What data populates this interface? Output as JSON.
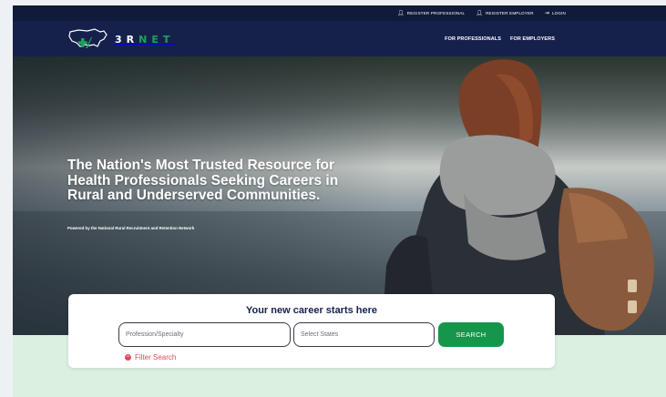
{
  "topbar": {
    "links": [
      {
        "label": "REGISTER PROFESSIONAL",
        "icon": "user-icon"
      },
      {
        "label": "REGISTER EMPLOYER",
        "icon": "user-icon"
      },
      {
        "label": "LOGIN",
        "icon": "login-icon"
      }
    ]
  },
  "nav": {
    "logo": "3RNET",
    "menu": [
      "FOR PROFESSIONALS",
      "FOR EMPLOYERS"
    ]
  },
  "hero": {
    "title": "The Nation's Most Trusted Resource for Health Professionals Seeking Careers in Rural and Underserved Communities.",
    "subtitle": "Powered by the National Rural Recruitment and Retention Network"
  },
  "search": {
    "heading": "Your new career starts here",
    "profession_placeholder": "Profession/Specialty",
    "states_placeholder": "Select States",
    "button_label": "SEARCH",
    "filter_label": "Filter Search"
  },
  "colors": {
    "navy": "#16214b",
    "green": "#16964b",
    "mint": "#dcf0e2",
    "red": "#e0475b"
  }
}
